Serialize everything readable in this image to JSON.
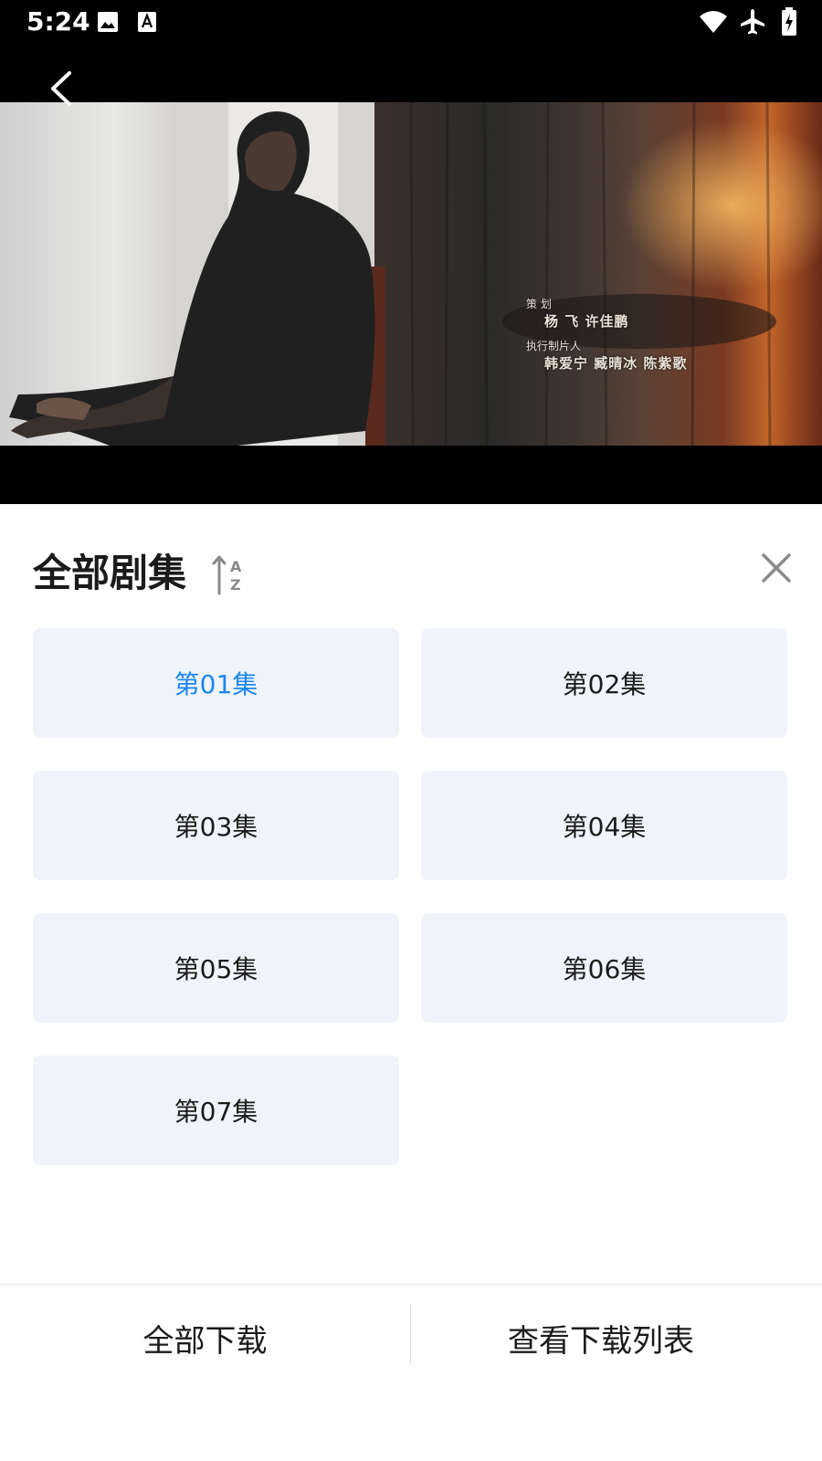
{
  "status_bar": {
    "time": "5:24",
    "left_icons": [
      "image-icon",
      "text-a-icon"
    ],
    "right_icons": [
      "wifi-icon",
      "airplane-icon",
      "battery-charging-icon"
    ]
  },
  "player": {
    "back_icon": "chevron-left-icon",
    "credits": [
      {
        "role": "策 划",
        "names": "杨 飞  许佳鹏"
      },
      {
        "role": "执行制片人",
        "names": "韩爱宁  臧晴冰  陈紫歌"
      }
    ]
  },
  "panel": {
    "title": "全部剧集",
    "sort_icon": "sort-az-icon",
    "close_icon": "close-icon",
    "episodes": [
      {
        "label": "第01集",
        "active": true
      },
      {
        "label": "第02集",
        "active": false
      },
      {
        "label": "第03集",
        "active": false
      },
      {
        "label": "第04集",
        "active": false
      },
      {
        "label": "第05集",
        "active": false
      },
      {
        "label": "第06集",
        "active": false
      },
      {
        "label": "第07集",
        "active": false
      }
    ],
    "accent_color": "#1a86f0"
  },
  "bottom": {
    "download_all": "全部下载",
    "view_downloads": "查看下载列表"
  }
}
